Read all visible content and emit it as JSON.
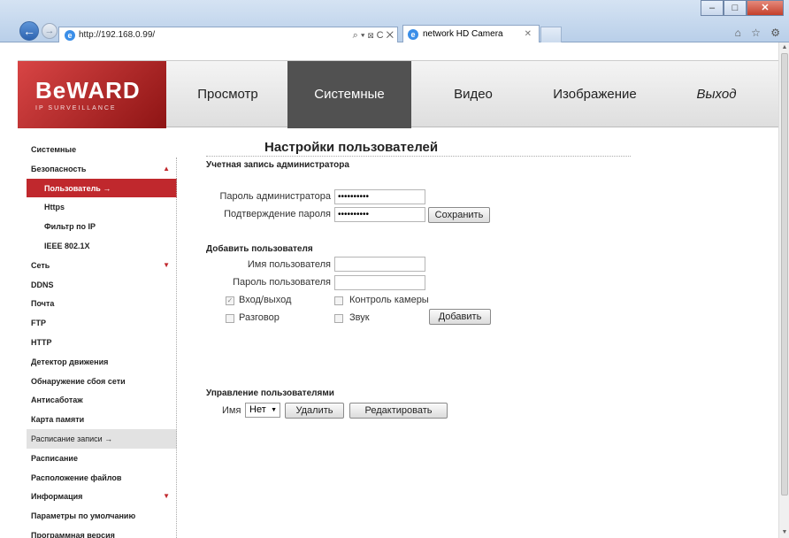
{
  "browser": {
    "url": "http://192.168.0.99/",
    "tab_title": "network HD Camera",
    "addr_controls": "⌕ ▾ ⊠ C ✕",
    "tab_close": "✕",
    "tool_icons": "⌂ ☆ ⚙",
    "window_buttons": [
      "–",
      "□",
      "✕"
    ],
    "back": "←",
    "forward": "→",
    "ie_glyph": "e"
  },
  "header": {
    "logo": "BeWARD",
    "logo_sub": "IP SURVEILLANCE",
    "menu": [
      "Просмотр",
      "Системные",
      "Видео",
      "Изображение",
      "Выход"
    ],
    "active_menu": "Системные"
  },
  "sidebar": {
    "items": [
      {
        "label": "Системные"
      },
      {
        "label": "Безопасность",
        "arrow": "▲"
      },
      {
        "label": "Пользователь →"
      },
      {
        "label": "Https"
      },
      {
        "label": "Фильтр по IP"
      },
      {
        "label": "IEEE 802.1X"
      },
      {
        "label": "Сеть",
        "arrow": "▼"
      },
      {
        "label": "DDNS"
      },
      {
        "label": "Почта"
      },
      {
        "label": "FTP"
      },
      {
        "label": "HTTP"
      },
      {
        "label": "Детектор движения"
      },
      {
        "label": "Обнаружение сбоя сети"
      },
      {
        "label": "Антисаботаж"
      },
      {
        "label": "Карта памяти"
      },
      {
        "label": "Расписание записи →"
      },
      {
        "label": "Расписание"
      },
      {
        "label": "Расположение файлов"
      },
      {
        "label": "Информация",
        "arrow": "▼"
      },
      {
        "label": "Параметры по умолчанию"
      },
      {
        "label": "Программная версия"
      }
    ]
  },
  "main": {
    "title": "Настройки пользователей",
    "admin": {
      "heading": "Учетная запись администратора",
      "password_label": "Пароль администратора",
      "password_value": "••••••••••",
      "confirm_label": "Подтверждение пароля",
      "confirm_value": "••••••••••",
      "save_button": "Сохранить"
    },
    "add_user": {
      "heading": "Добавить пользователя",
      "username_label": "Имя пользователя",
      "username_value": "",
      "password_label": "Пароль пользователя",
      "password_value": "",
      "login_label": "Вход/выход",
      "camera_control_label": "Контроль камеры",
      "talk_label": "Разговор",
      "sound_label": "Звук",
      "check_mark": "✓",
      "add_button": "Добавить"
    },
    "manage": {
      "heading": "Управление пользователями",
      "name_label": "Имя",
      "select_value": "Нет",
      "select_caret": "▼",
      "delete_button": "Удалить",
      "edit_button": "Редактировать"
    }
  }
}
